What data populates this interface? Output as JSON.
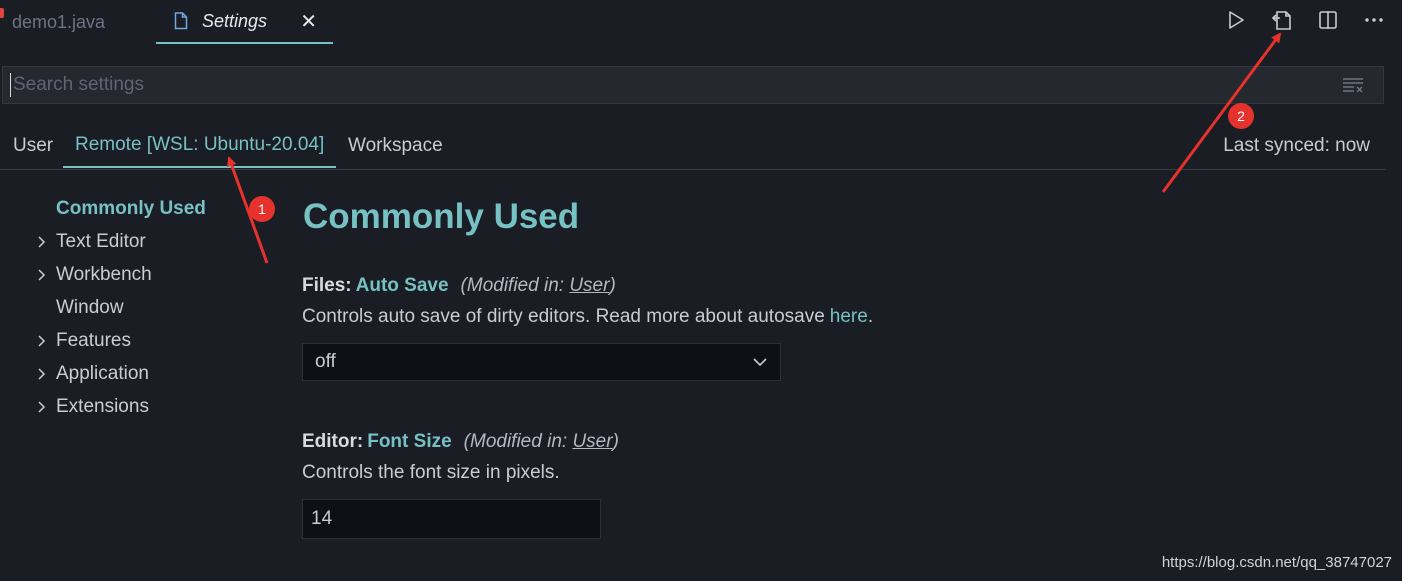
{
  "tabs": [
    {
      "label": "demo1.java",
      "active": false
    },
    {
      "label": "Settings",
      "active": true
    }
  ],
  "actions": [
    {
      "name": "run-icon"
    },
    {
      "name": "open-settings-json-icon"
    },
    {
      "name": "split-editor-icon"
    },
    {
      "name": "more-actions-icon"
    }
  ],
  "search": {
    "placeholder": "Search settings"
  },
  "scopes": {
    "user": "User",
    "remote": "Remote [WSL: Ubuntu-20.04]",
    "workspace": "Workspace",
    "synced": "Last synced: now"
  },
  "toc": {
    "items": [
      {
        "label": "Commonly Used",
        "expandable": false,
        "selected": true
      },
      {
        "label": "Text Editor",
        "expandable": true
      },
      {
        "label": "Workbench",
        "expandable": true
      },
      {
        "label": "Window",
        "expandable": false
      },
      {
        "label": "Features",
        "expandable": true
      },
      {
        "label": "Application",
        "expandable": true
      },
      {
        "label": "Extensions",
        "expandable": true
      }
    ]
  },
  "main": {
    "section_title": "Commonly Used",
    "auto_save": {
      "category": "Files:",
      "key": "Auto Save",
      "modified_prefix": "(Modified in: ",
      "modified_link": "User",
      "modified_suffix": ")",
      "description": "Controls auto save of dirty editors. Read more about autosave",
      "description_link": "here",
      "description_end": ".",
      "value": "off"
    },
    "font_size": {
      "category": "Editor:",
      "key": "Font Size",
      "modified_prefix": "(Modified in: ",
      "modified_link": "User",
      "modified_suffix": ")",
      "description": "Controls the font size in pixels.",
      "value": "14"
    }
  },
  "annotations": {
    "badge1": "1",
    "badge2": "2"
  },
  "watermark": "https://blog.csdn.net/qq_38747027",
  "colors": {
    "accent": "#76c1c4",
    "background": "#1b1d25",
    "annotation": "#e5322d"
  }
}
